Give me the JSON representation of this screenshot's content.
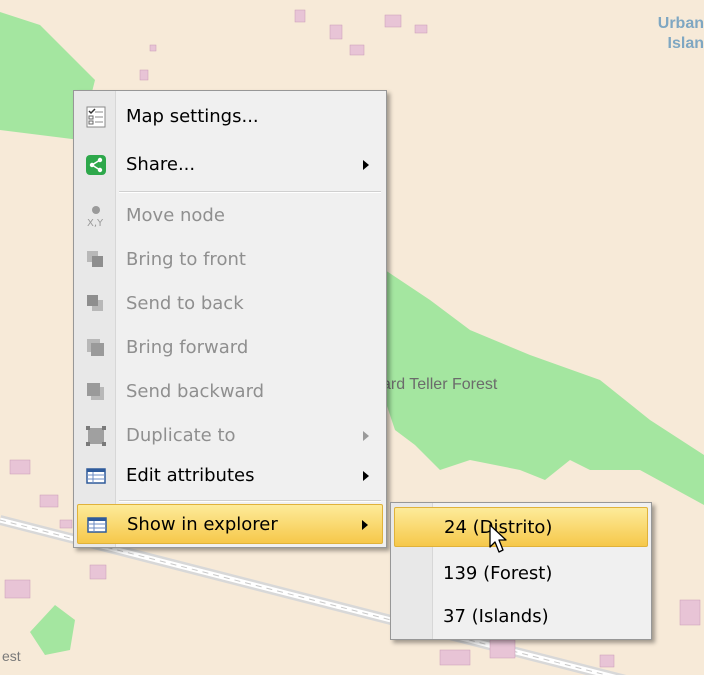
{
  "map": {
    "top_right_label_lines": [
      "Urban",
      "Islan"
    ],
    "forest_label": "ard Teller Forest",
    "bottom_left_label": "est"
  },
  "context_menu": {
    "items": [
      {
        "label": "Map settings...",
        "icon": "map-settings-icon",
        "enabled": true,
        "has_submenu": false
      },
      {
        "label": "Share...",
        "icon": "share-icon",
        "enabled": true,
        "has_submenu": true
      },
      {
        "label": "Move node",
        "icon": "move-node-icon",
        "enabled": false,
        "has_submenu": false
      },
      {
        "label": "Bring to front",
        "icon": "bring-to-front-icon",
        "enabled": false,
        "has_submenu": false
      },
      {
        "label": "Send to back",
        "icon": "send-to-back-icon",
        "enabled": false,
        "has_submenu": false
      },
      {
        "label": "Bring forward",
        "icon": "bring-forward-icon",
        "enabled": false,
        "has_submenu": false
      },
      {
        "label": "Send backward",
        "icon": "send-backward-icon",
        "enabled": false,
        "has_submenu": false
      },
      {
        "label": "Duplicate to",
        "icon": "duplicate-icon",
        "enabled": false,
        "has_submenu": true
      },
      {
        "label": "Edit attributes",
        "icon": "table-icon",
        "enabled": true,
        "has_submenu": true
      },
      {
        "label": "Show in explorer",
        "icon": "table-icon",
        "enabled": true,
        "has_submenu": true,
        "highlighted": true
      }
    ]
  },
  "submenu": {
    "items": [
      {
        "label": "24 (Distrito)",
        "highlighted": true
      },
      {
        "label": "139 (Forest)",
        "highlighted": false
      },
      {
        "label": "37 (Islands)",
        "highlighted": false
      }
    ]
  },
  "colors": {
    "map_background": "#f7ead8",
    "forest_green": "#a4e6a0",
    "road": "#dcdcdc",
    "buildings": "#e8c4d6",
    "highlight": "#f6c84a",
    "share_icon_green": "#2ea84b"
  }
}
